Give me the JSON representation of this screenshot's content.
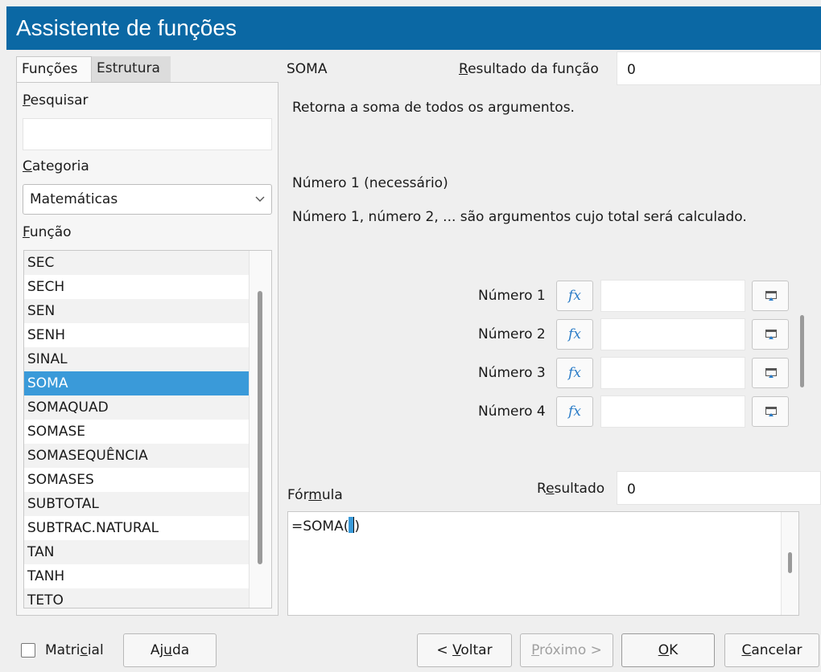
{
  "window": {
    "title": "Assistente de funções"
  },
  "tabs": [
    {
      "label": "Funções",
      "active": true
    },
    {
      "label": "Estrutura",
      "active": false
    }
  ],
  "search": {
    "label_access": "P",
    "label_rest": "esquisar",
    "value": ""
  },
  "category": {
    "label_access": "C",
    "label_rest": "ategoria",
    "selected": "Matemáticas"
  },
  "function_list": {
    "label_access": "F",
    "label_rest": "unção",
    "items": [
      "SEC",
      "SECH",
      "SEN",
      "SENH",
      "SINAL",
      "SOMA",
      "SOMAQUAD",
      "SOMASE",
      "SOMASEQUÊNCIA",
      "SOMASES",
      "SUBTOTAL",
      "SUBTRAC.NATURAL",
      "TAN",
      "TANH",
      "TETO"
    ],
    "selected": "SOMA"
  },
  "function": {
    "name": "SOMA",
    "result_label_access": "R",
    "result_label_rest": "esultado da função",
    "result_value": "0",
    "description": "Retorna a soma de todos os argumentos.",
    "arg_title": "Número 1 (necessário)",
    "arg_description": "Número 1, número 2, ... são argumentos cujo total será calculado."
  },
  "arguments": [
    {
      "label": "Número 1",
      "value": ""
    },
    {
      "label": "Número 2",
      "value": ""
    },
    {
      "label": "Número 3",
      "value": ""
    },
    {
      "label": "Número 4",
      "value": ""
    }
  ],
  "fx_icon_text": "fx",
  "formula": {
    "label_pre": "Fór",
    "label_access": "m",
    "label_post": "ula",
    "result_label_pre": "R",
    "result_label_access": "e",
    "result_label_post": "sultado",
    "result_value": "0",
    "text_before": "=SOMA(",
    "text_cursor": "",
    "text_after": ")"
  },
  "footer": {
    "array_pre": "Matri",
    "array_access": "c",
    "array_post": "ial",
    "help_pre": "Aj",
    "help_access": "u",
    "help_post": "da",
    "back_pre": "< ",
    "back_access": "V",
    "back_post": "oltar",
    "next_access": "P",
    "next_post": "róximo >",
    "ok_access": "O",
    "ok_post": "K",
    "cancel_access": "C",
    "cancel_post": "ancelar"
  }
}
